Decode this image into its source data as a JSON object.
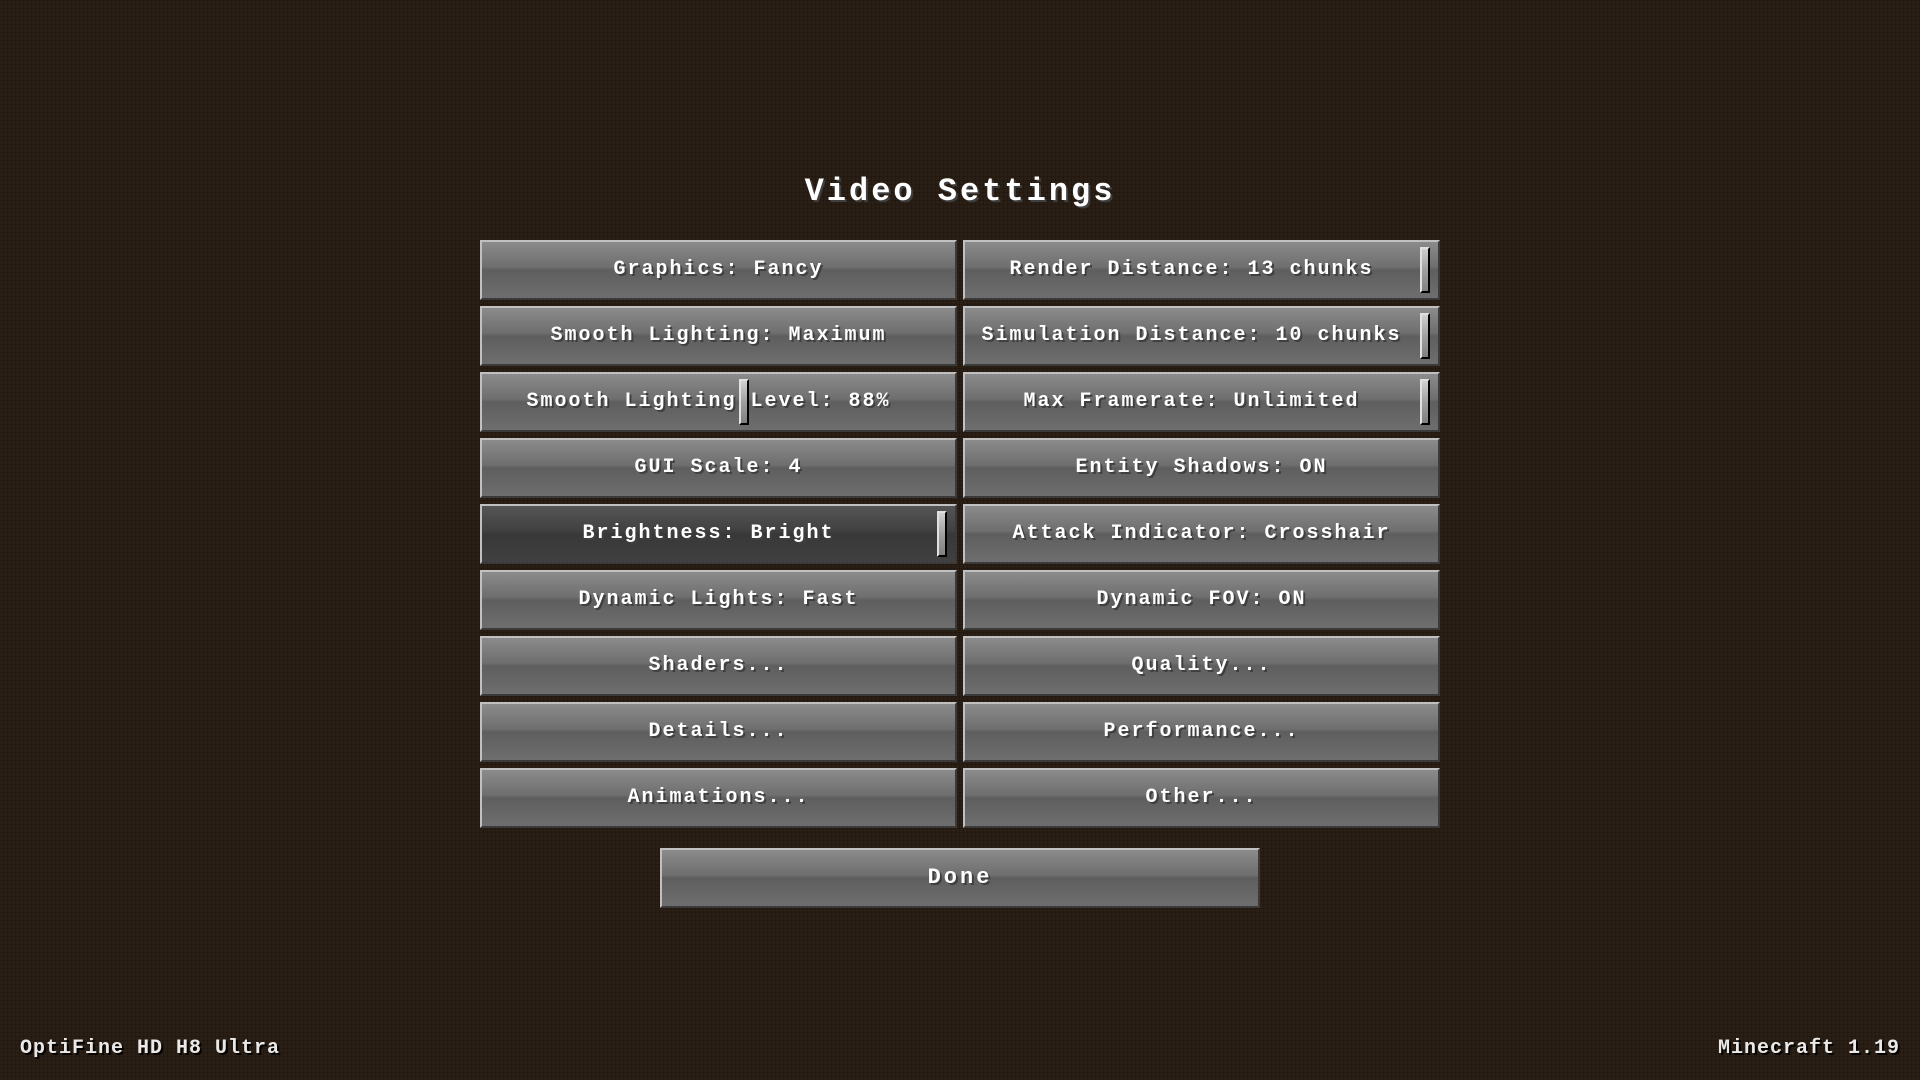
{
  "title": "Video Settings",
  "left_buttons": [
    {
      "id": "graphics",
      "label": "Graphics: Fancy",
      "active": false,
      "slider": false
    },
    {
      "id": "smooth-lighting",
      "label": "Smooth Lighting: Maximum",
      "active": false,
      "slider": false
    },
    {
      "id": "smooth-lighting-level",
      "label": "Smooth Lighting Level: 88%",
      "active": false,
      "slider": true,
      "slider_pos": "mid"
    },
    {
      "id": "gui-scale",
      "label": "GUI Scale: 4",
      "active": false,
      "slider": false
    },
    {
      "id": "brightness",
      "label": "Brightness: Bright",
      "active": true,
      "slider": true,
      "slider_pos": "right"
    },
    {
      "id": "dynamic-lights",
      "label": "Dynamic Lights: Fast",
      "active": false,
      "slider": false
    },
    {
      "id": "shaders",
      "label": "Shaders...",
      "active": false,
      "slider": false
    },
    {
      "id": "details",
      "label": "Details...",
      "active": false,
      "slider": false
    },
    {
      "id": "animations",
      "label": "Animations...",
      "active": false,
      "slider": false
    }
  ],
  "right_buttons": [
    {
      "id": "render-distance",
      "label": "Render Distance: 13 chunks",
      "active": false,
      "slider": true,
      "slider_pos": "mid"
    },
    {
      "id": "simulation-distance",
      "label": "Simulation Distance: 10 chunks",
      "active": false,
      "slider": true,
      "slider_pos": "mid"
    },
    {
      "id": "max-framerate",
      "label": "Max Framerate: Unlimited",
      "active": false,
      "slider": true,
      "slider_pos": "right"
    },
    {
      "id": "entity-shadows",
      "label": "Entity Shadows: ON",
      "active": false,
      "slider": false
    },
    {
      "id": "attack-indicator",
      "label": "Attack Indicator: Crosshair",
      "active": false,
      "slider": false
    },
    {
      "id": "dynamic-fov",
      "label": "Dynamic FOV: ON",
      "active": false,
      "slider": false
    },
    {
      "id": "quality",
      "label": "Quality...",
      "active": false,
      "slider": false
    },
    {
      "id": "performance",
      "label": "Performance...",
      "active": false,
      "slider": false
    },
    {
      "id": "other",
      "label": "Other...",
      "active": false,
      "slider": false
    }
  ],
  "done_button": "Done",
  "bottom_left": "OptiFine HD H8 Ultra",
  "bottom_right": "Minecraft 1.19"
}
